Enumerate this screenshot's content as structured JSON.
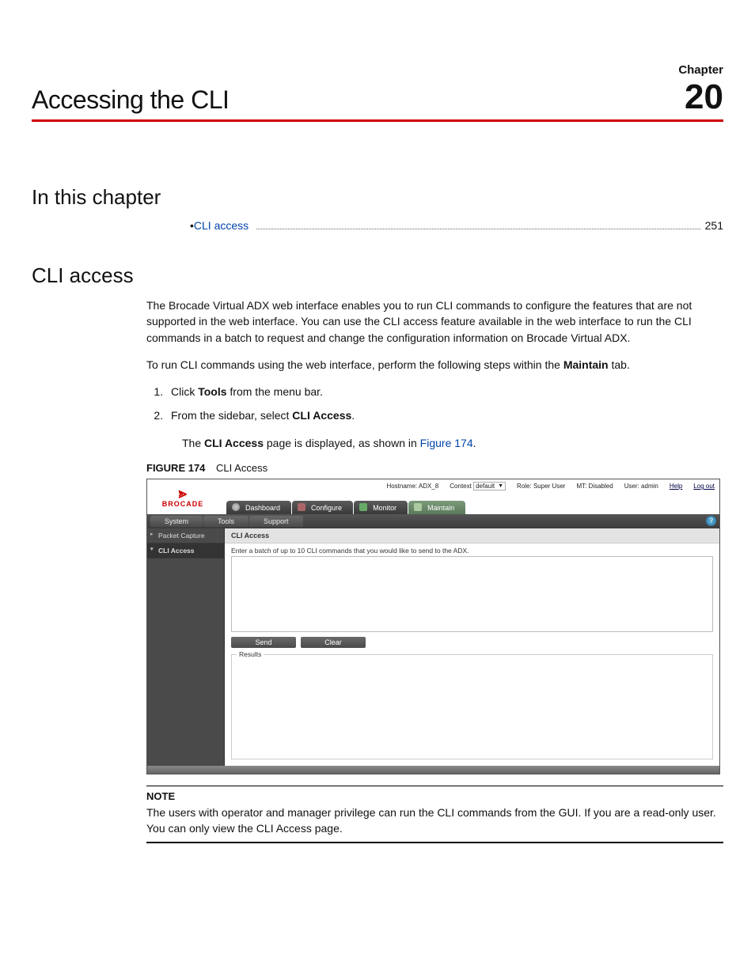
{
  "chapter": {
    "label": "Chapter",
    "number": "20",
    "title": "Accessing the CLI"
  },
  "sections": {
    "in_this_chapter": "In this chapter",
    "cli_access": "CLI access"
  },
  "toc": {
    "item": "CLI access",
    "page": "251",
    "bullet": "•"
  },
  "paragraphs": {
    "p1": "The Brocade Virtual ADX web interface enables you to run CLI commands to configure the features that are not supported in the web interface. You can use the CLI access feature available in the web interface to run the CLI commands in a batch to request and change the configuration information on Brocade Virtual ADX.",
    "p2_a": "To run CLI commands using the web interface, perform the following steps within the ",
    "p2_b": "Maintain",
    "p2_c": " tab.",
    "step1_a": "Click ",
    "step1_b": "Tools",
    "step1_c": " from the menu bar.",
    "step2_a": "From the sidebar, select ",
    "step2_b": "CLI Access",
    "step2_c": ".",
    "sub_a": "The ",
    "sub_b": "CLI Access",
    "sub_c": " page is displayed, as shown in ",
    "sub_link": "Figure 174",
    "sub_d": "."
  },
  "figure": {
    "label": "FIGURE 174",
    "caption": "CLI Access"
  },
  "screenshot": {
    "logo_text": "BROCADE",
    "header": {
      "hostname_label": "Hostname:",
      "hostname_value": "ADX_8",
      "context_label": "Context",
      "context_value": "default",
      "role_label": "Role:",
      "role_value": "Super User",
      "mt_label": "MT: Disabled",
      "user_label": "User:",
      "user_value": "admin",
      "help": "Help",
      "logout": "Log out"
    },
    "tabs": {
      "dashboard": "Dashboard",
      "configure": "Configure",
      "monitor": "Monitor",
      "maintain": "Maintain"
    },
    "subtabs": {
      "system": "System",
      "tools": "Tools",
      "support": "Support"
    },
    "help_icon": "?",
    "sidebar": {
      "packet_capture": "Packet Capture",
      "cli_access": "CLI Access"
    },
    "main": {
      "title": "CLI Access",
      "instruction": "Enter a batch of up to 10 CLI commands that you would like to send to the ADX.",
      "send": "Send",
      "clear": "Clear",
      "results": "Results"
    }
  },
  "note": {
    "label": "NOTE",
    "text": "The users with operator and manager privilege can run the CLI commands from the GUI. If you are a read-only user. You can only view the CLI Access page."
  }
}
